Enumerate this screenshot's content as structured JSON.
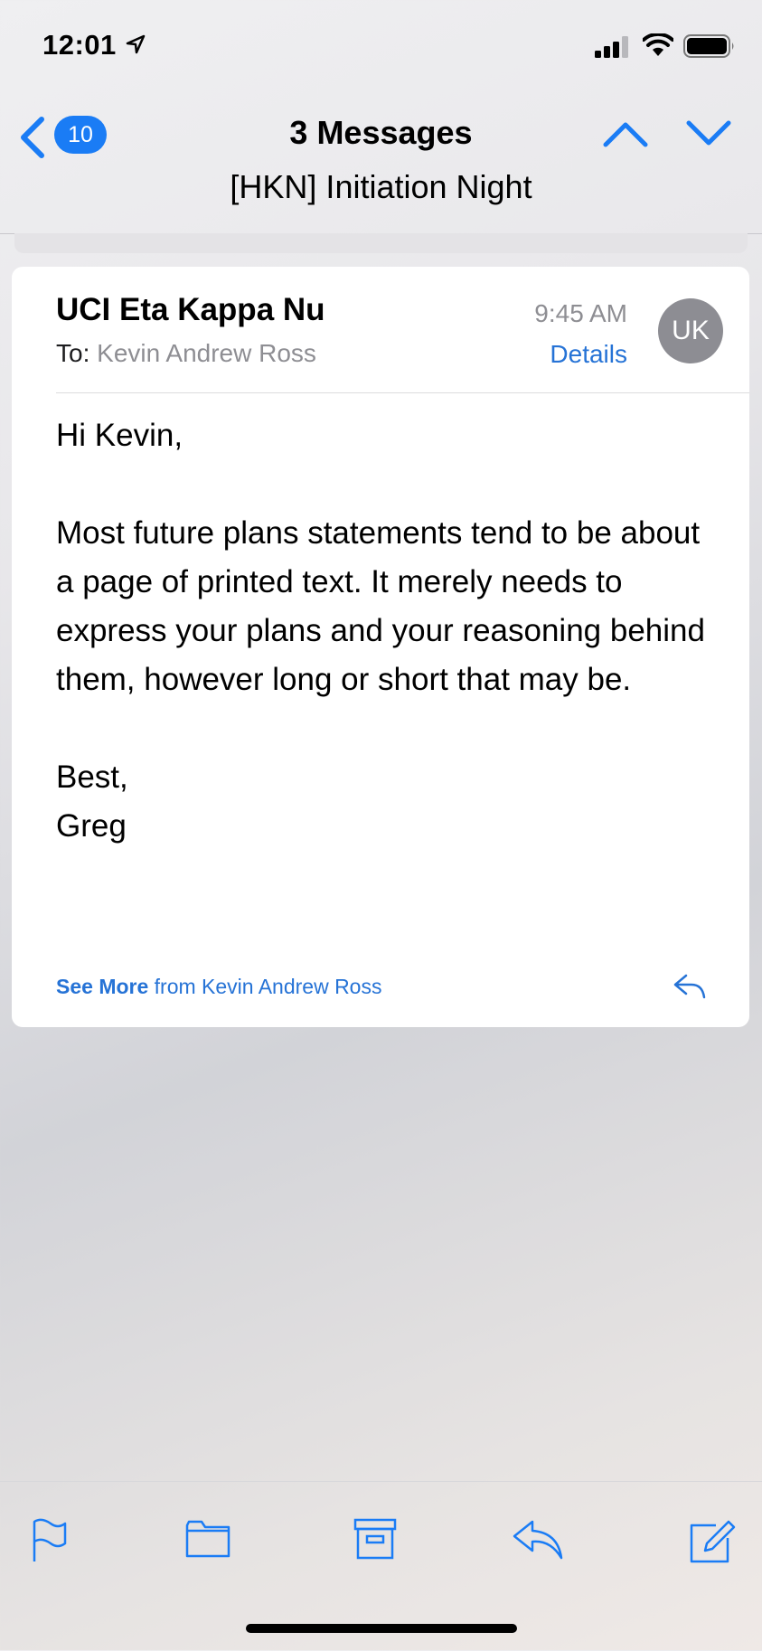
{
  "status_bar": {
    "time": "12:01"
  },
  "nav": {
    "unread_count": "10",
    "title": "3 Messages",
    "subtitle": "[HKN] Initiation Night"
  },
  "message": {
    "sender": "UCI Eta Kappa Nu",
    "to_label": "To:",
    "to_name": "Kevin Andrew Ross",
    "time": "9:45 AM",
    "details_label": "Details",
    "avatar_initials": "UK",
    "body": {
      "greeting": "Hi Kevin,",
      "paragraph": "Most future plans statements tend to be about a page of printed text. It merely needs to express your plans and your reasoning behind them, however long or short that may be.",
      "closing": "Best,",
      "signature": "Greg"
    },
    "see_more_label": "See More",
    "see_more_suffix": " from Kevin Andrew Ross"
  },
  "toolbar": {
    "icons": [
      "flag-icon",
      "folder-icon",
      "archive-icon",
      "reply-icon",
      "compose-icon"
    ]
  },
  "colors": {
    "accent": "#1a7cf5",
    "link": "#2673d6",
    "secondary_text": "#8e8e93"
  }
}
